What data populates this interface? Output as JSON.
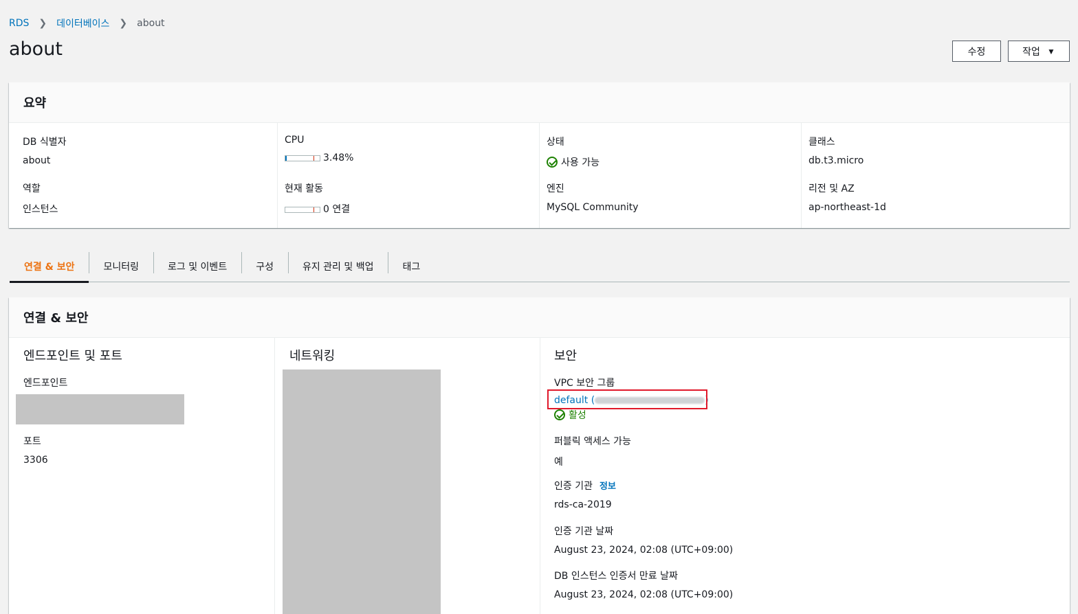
{
  "breadcrumb": {
    "items": [
      "RDS",
      "데이터베이스"
    ],
    "current": "about"
  },
  "page": {
    "title": "about"
  },
  "header_buttons": {
    "edit": "수정",
    "actions": "작업"
  },
  "summary": {
    "title": "요약",
    "db_identifier": {
      "label": "DB 식별자",
      "value": "about"
    },
    "role": {
      "label": "역할",
      "value": "인스턴스"
    },
    "cpu": {
      "label": "CPU",
      "value": "3.48%",
      "percent": 3.48
    },
    "activity": {
      "label": "현재 활동",
      "value": "0 연결",
      "percent": 0
    },
    "status": {
      "label": "상태",
      "value": "사용 가능"
    },
    "engine": {
      "label": "엔진",
      "value": "MySQL Community"
    },
    "class": {
      "label": "클래스",
      "value": "db.t3.micro"
    },
    "region": {
      "label": "리전 및 AZ",
      "value": "ap-northeast-1d"
    }
  },
  "tabs": [
    {
      "label": "연결 & 보안",
      "active": true
    },
    {
      "label": "모니터링",
      "active": false
    },
    {
      "label": "로그 및 이벤트",
      "active": false
    },
    {
      "label": "구성",
      "active": false
    },
    {
      "label": "유지 관리 및 백업",
      "active": false
    },
    {
      "label": "태그",
      "active": false
    }
  ],
  "connectivity": {
    "title": "연결 & 보안",
    "endpoint_section": {
      "title": "엔드포인트 및 포트",
      "endpoint_label": "엔드포인트",
      "port_label": "포트",
      "port_value": "3306"
    },
    "network_section": {
      "title": "네트워킹"
    },
    "security_section": {
      "title": "보안",
      "vpc_label": "VPC 보안 그룹",
      "vpc_group_name": "default",
      "vpc_status": "활성",
      "public_label": "퍼블릭 액세스 가능",
      "public_value": "예",
      "ca_label": "인증 기관",
      "ca_info": "정보",
      "ca_value": "rds-ca-2019",
      "ca_date_label": "인증 기관 날짜",
      "ca_date_value": "August 23, 2024, 02:08 (UTC+09:00)",
      "cert_expiry_label": "DB 인스턴스 인증서 만료 날짜",
      "cert_expiry_value": "August 23, 2024, 02:08 (UTC+09:00)"
    }
  },
  "colors": {
    "link": "#0073bb",
    "active_tab": "#ec7211",
    "success": "#1d8102",
    "highlight": "#e0182a"
  }
}
